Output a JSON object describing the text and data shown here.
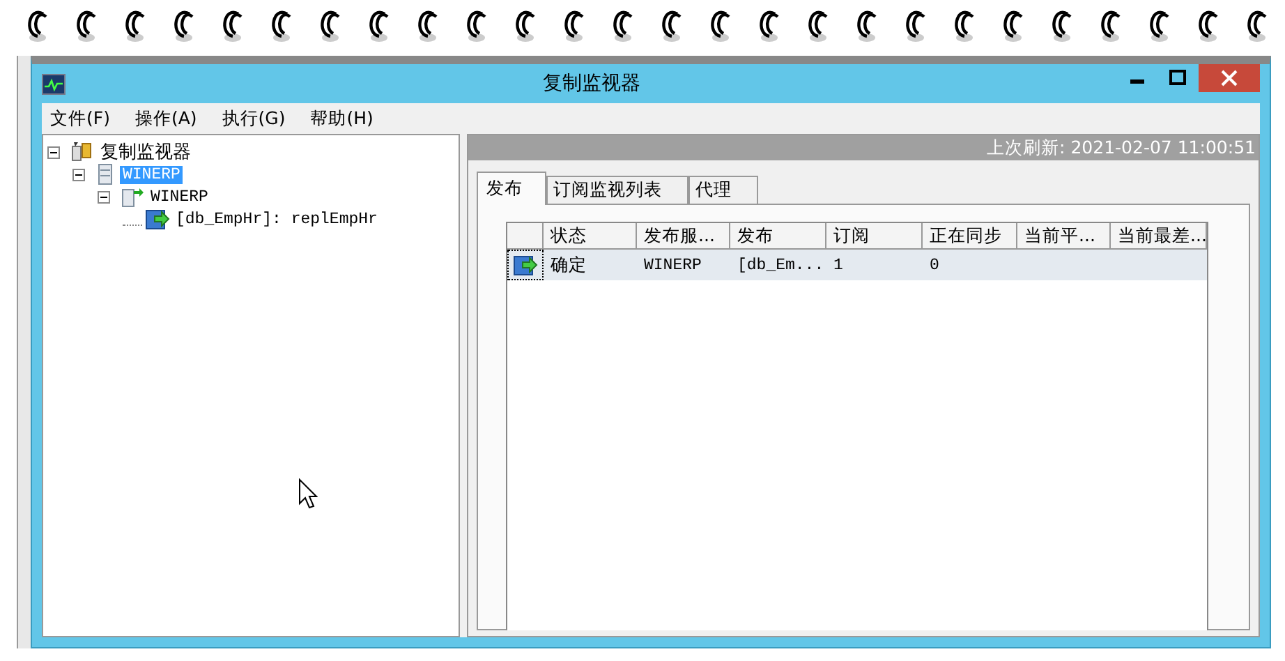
{
  "window": {
    "title": "复制监视器"
  },
  "menu": [
    {
      "label": "文件(F)"
    },
    {
      "label": "操作(A)"
    },
    {
      "label": "执行(G)"
    },
    {
      "label": "帮助(H)"
    }
  ],
  "tree": [
    {
      "label": "复制监视器",
      "kind": "root",
      "expanded": true,
      "selected": false,
      "children": [
        {
          "label": "WINERP",
          "kind": "server",
          "expanded": true,
          "selected": true,
          "children": [
            {
              "label": "WINERP",
              "kind": "publisher",
              "expanded": true,
              "selected": false,
              "children": [
                {
                  "label": "[db_EmpHr]: replEmpHr",
                  "kind": "publication",
                  "selected": false
                }
              ]
            }
          ]
        }
      ]
    }
  ],
  "status": {
    "last_refresh": "上次刷新: 2021-02-07 11:00:51"
  },
  "tabs": [
    {
      "label": "发布",
      "selected": true
    },
    {
      "label": "订阅监视列表",
      "selected": false
    },
    {
      "label": "代理",
      "selected": false
    }
  ],
  "table": {
    "columns": [
      "状态",
      "发布服...",
      "发布",
      "订阅",
      "正在同步",
      "当前平...",
      "当前最差..."
    ],
    "rows": [
      {
        "selected": true,
        "cells": [
          "确定",
          "WINERP",
          "[db_Em...",
          "1",
          "0"
        ]
      }
    ]
  }
}
